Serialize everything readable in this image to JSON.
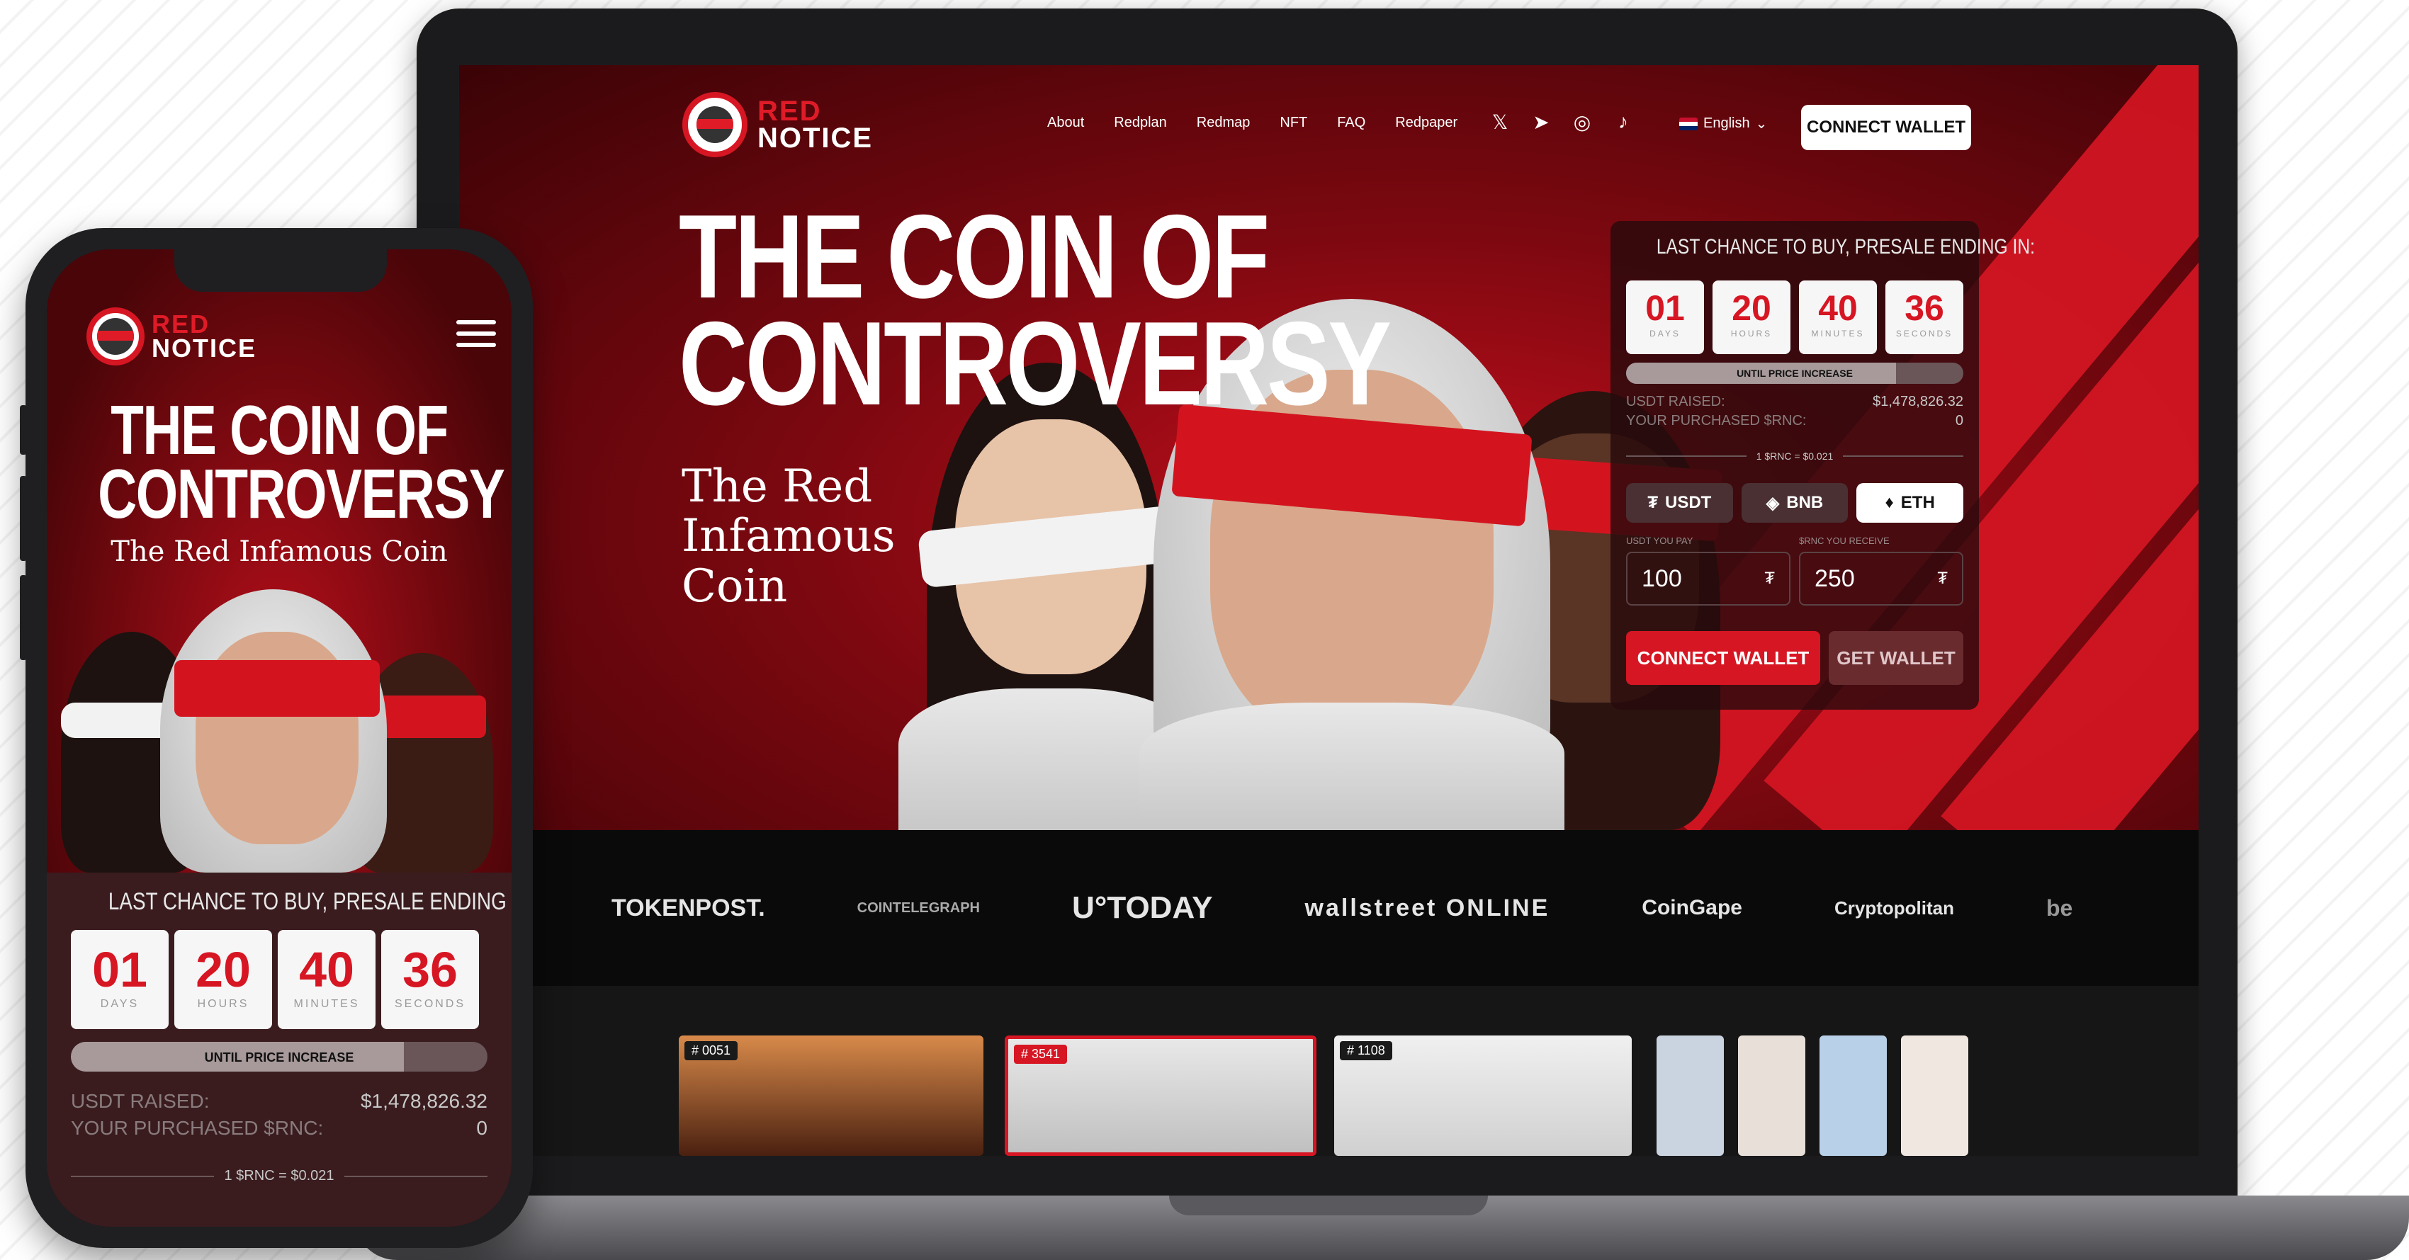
{
  "brand": {
    "line1": "RED",
    "line2": "NOTICE"
  },
  "nav": {
    "links": [
      "About",
      "Redplan",
      "Redmap",
      "NFT",
      "FAQ",
      "Redpaper"
    ],
    "social_icons": [
      "x-icon",
      "telegram-icon",
      "instagram-icon",
      "tiktok-icon"
    ],
    "social_glyphs": [
      "𝕏",
      "➤",
      "◎",
      "♪"
    ],
    "language": "English",
    "connect_label": "CONNECT WALLET"
  },
  "hero": {
    "title_line1": "THE COIN OF",
    "title_line2": "CONTROVERSY",
    "subtitle_line1": "The Red",
    "subtitle_line2": "Infamous",
    "subtitle_line3": "Coin"
  },
  "presale": {
    "title": "LAST CHANCE TO BUY, PRESALE ENDING IN:",
    "countdown": [
      {
        "value": "01",
        "unit": "DAYS"
      },
      {
        "value": "20",
        "unit": "HOURS"
      },
      {
        "value": "40",
        "unit": "MINUTES"
      },
      {
        "value": "36",
        "unit": "SECONDS"
      }
    ],
    "progress_label": "UNTIL PRICE INCREASE",
    "progress_fraction": 0.8,
    "usdt_raised_label": "USDT RAISED:",
    "usdt_raised_value": "$1,478,826.32",
    "purchased_label": "YOUR PURCHASED $RNC:",
    "purchased_value": "0",
    "rate": "1 $RNC = $0.021",
    "currencies": [
      {
        "label": "USDT",
        "icon": "tether-icon",
        "glyph": "₮",
        "active": false
      },
      {
        "label": "BNB",
        "icon": "bnb-icon",
        "glyph": "◈",
        "active": false
      },
      {
        "label": "ETH",
        "icon": "eth-icon",
        "glyph": "♦",
        "active": true
      }
    ],
    "pay_label": "USDT YOU PAY",
    "receive_label": "$RNC YOU RECEIVE",
    "pay_value": "100",
    "receive_value": "250",
    "token_glyph": "₮",
    "connect_label": "CONNECT WALLET",
    "get_label": "GET WALLET"
  },
  "press": [
    "TOKENPOST.",
    "COINTELEGRAPH",
    "U°TODAY",
    "wallstreet ONLINE",
    "CoinGape",
    "Cryptopolitan",
    "be"
  ],
  "nfts": [
    {
      "tag": "# 0051"
    },
    {
      "tag": "# 3541"
    },
    {
      "tag": "# 1108"
    }
  ],
  "colors": {
    "accent": "#d71623",
    "dark": "#0c0c0c"
  }
}
